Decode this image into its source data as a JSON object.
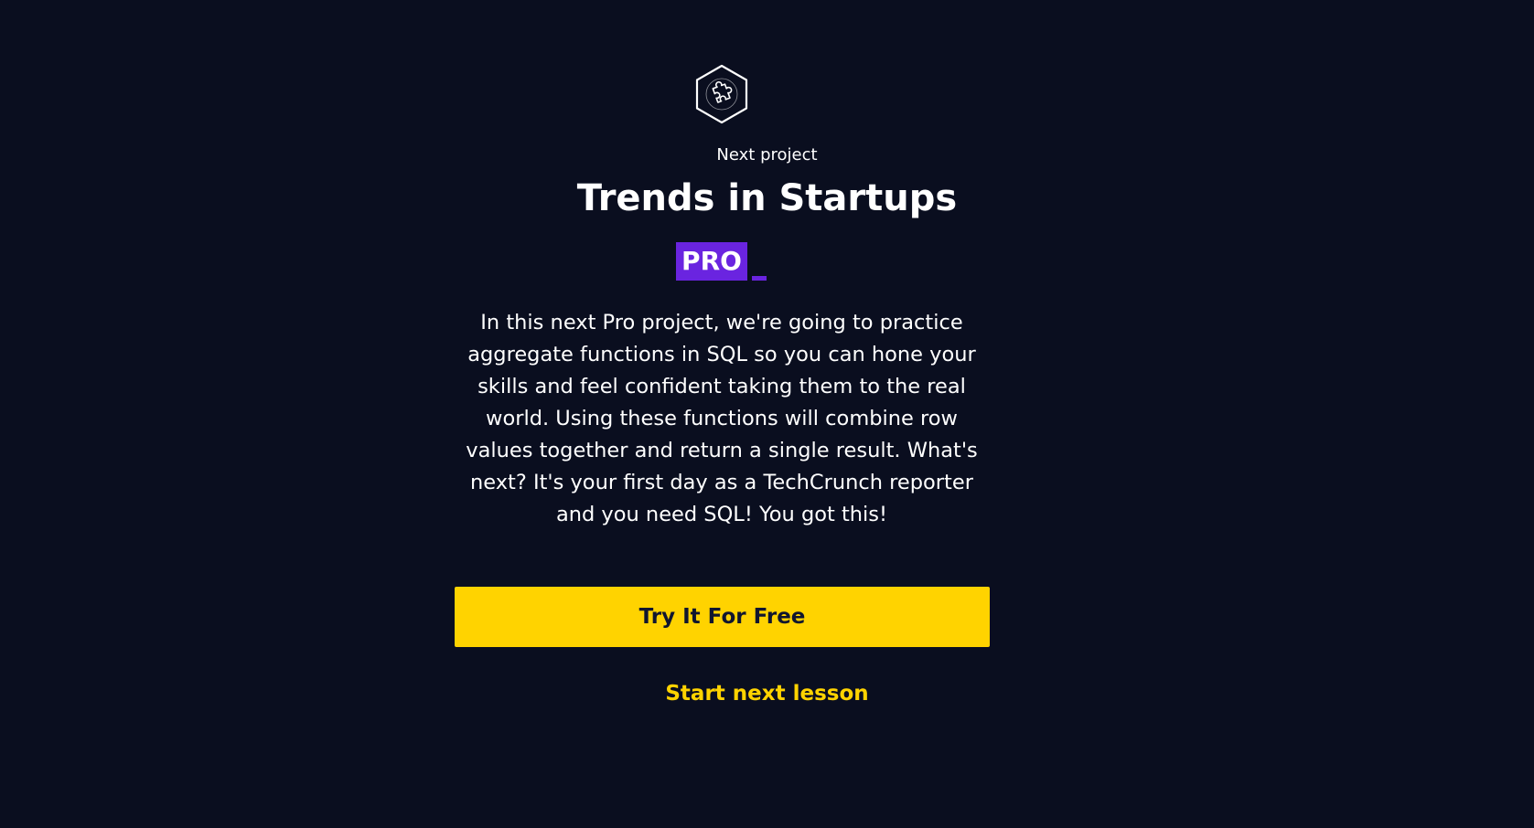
{
  "project": {
    "icon": "puzzle-hexagon-icon",
    "eyebrow": "Next project",
    "title": "Trends in Startups",
    "badge": "PRO",
    "description": "In this next Pro project, we're going to practice aggregate functions in SQL so you can hone your skills and feel confident taking them to the real world. Using these functions will combine row values together and return a single result. What's next? It's your first day as a TechCrunch reporter and you need SQL! You got this!"
  },
  "actions": {
    "primary_label": "Try It For Free",
    "secondary_label": "Start next lesson"
  },
  "colors": {
    "background": "#0a0e1f",
    "badge": "#6a24e0",
    "accent": "#ffd300",
    "button_text": "#10162f",
    "text": "#ffffff"
  }
}
